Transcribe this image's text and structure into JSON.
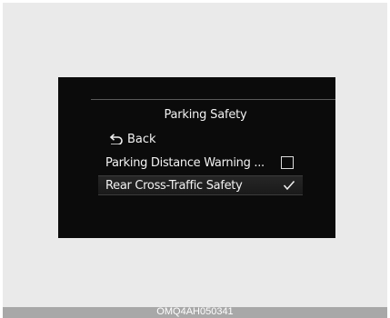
{
  "screen": {
    "title": "Parking Safety",
    "back_label": "Back",
    "items": [
      {
        "label": "Parking Distance Warning ...",
        "checked": false
      },
      {
        "label": "Rear Cross-Traffic Safety",
        "checked": true
      }
    ]
  },
  "caption": "OMQ4AH050341",
  "icons": {
    "back": "back-arrow-icon",
    "checkbox_empty": "checkbox-empty-icon",
    "checkmark": "checkmark-icon"
  }
}
